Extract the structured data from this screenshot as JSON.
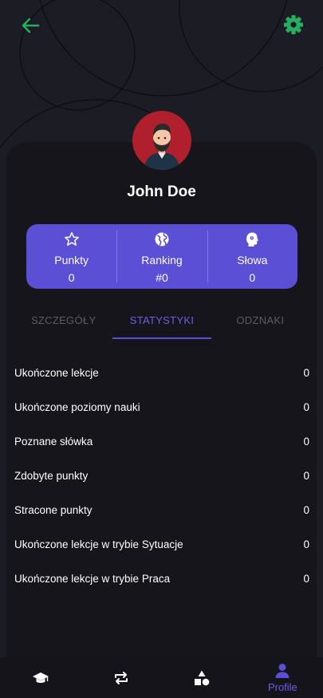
{
  "header": {
    "back_icon": "arrow-left-icon",
    "settings_icon": "gear-icon"
  },
  "colors": {
    "accent": "#5b4fd6",
    "accent_text": "#6a5fe8",
    "green": "#27ae60",
    "avatar_bg": "#b0202c",
    "background": "#1c1c24",
    "card": "#15151b"
  },
  "profile": {
    "name": "John Doe",
    "avatar_icon": "bearded-man-avatar"
  },
  "stats": [
    {
      "icon": "star-icon",
      "label": "Punkty",
      "value": "0"
    },
    {
      "icon": "globe-icon",
      "label": "Ranking",
      "value": "#0"
    },
    {
      "icon": "brain-head-icon",
      "label": "Słowa",
      "value": "0"
    }
  ],
  "tabs": [
    {
      "label": "SZCZEGÓŁY",
      "active": false
    },
    {
      "label": "STATYSTYKI",
      "active": true
    },
    {
      "label": "ODZNAKI",
      "active": false
    }
  ],
  "statistics": [
    {
      "label": "Ukończone lekcje",
      "value": "0"
    },
    {
      "label": "Ukończone poziomy nauki",
      "value": "0"
    },
    {
      "label": "Poznane słówka",
      "value": "0"
    },
    {
      "label": "Zdobyte punkty",
      "value": "0"
    },
    {
      "label": "Stracone punkty",
      "value": "0"
    },
    {
      "label": "Ukończone lekcje w trybie Sytuacje",
      "value": "0"
    },
    {
      "label": "Ukończone lekcje w trybie Praca",
      "value": "0"
    }
  ],
  "bottom_nav": [
    {
      "icon": "graduation-cap-icon",
      "label": "",
      "active": false
    },
    {
      "icon": "repeat-icon",
      "label": "",
      "active": false
    },
    {
      "icon": "shapes-icon",
      "label": "",
      "active": false
    },
    {
      "icon": "person-icon",
      "label": "Profile",
      "active": true
    }
  ]
}
